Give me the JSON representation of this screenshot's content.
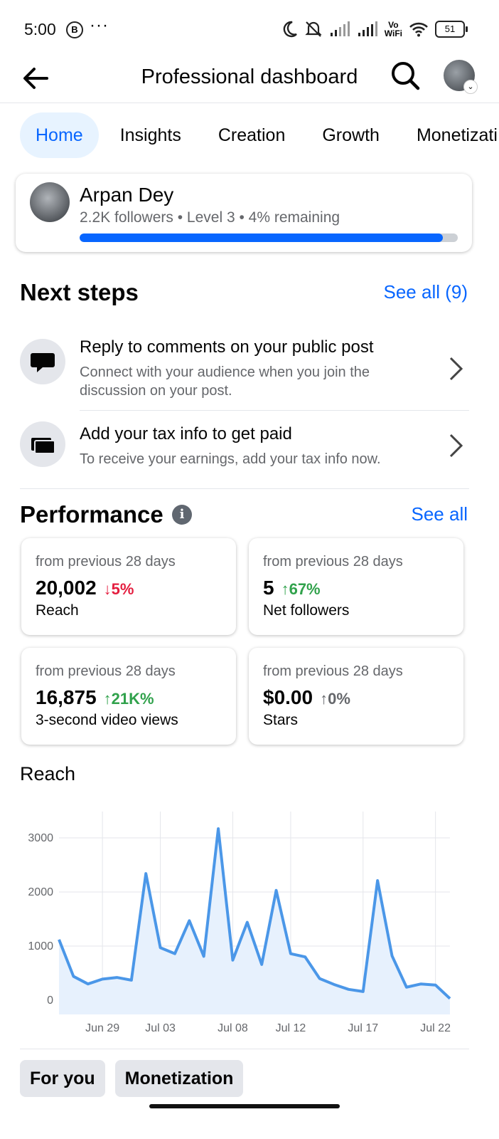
{
  "status_bar": {
    "time": "5:00",
    "b_badge": "B",
    "dots": "···",
    "vo": "Vo",
    "wifi_label": "WiFi",
    "battery": "51"
  },
  "header": {
    "title": "Professional dashboard"
  },
  "tabs": [
    {
      "label": "Home",
      "active": true
    },
    {
      "label": "Insights"
    },
    {
      "label": "Creation"
    },
    {
      "label": "Growth"
    },
    {
      "label": "Monetizati"
    }
  ],
  "profile": {
    "name": "Arpan Dey",
    "meta": "2.2K followers • Level 3 • 4% remaining",
    "progress_fraction": 0.96
  },
  "next_steps": {
    "heading": "Next steps",
    "see_all": "See all (9)",
    "items": [
      {
        "title": "Reply to comments on your public post",
        "desc": "Connect with your audience when you join the discussion on your post.",
        "icon": "comment-bubble-icon"
      },
      {
        "title": "Add your tax info to get paid",
        "desc": "To receive your earnings, add your tax info now.",
        "icon": "cards-icon"
      }
    ]
  },
  "performance": {
    "heading": "Performance",
    "see_all": "See all",
    "cards": [
      {
        "caption": "from previous 28 days",
        "value": "20,002",
        "change": "↓5%",
        "trend": "down",
        "label": "Reach"
      },
      {
        "caption": "from previous 28 days",
        "value": "5",
        "change": "↑67%",
        "trend": "up",
        "label": "Net followers"
      },
      {
        "caption": "from previous 28 days",
        "value": "16,875",
        "change": "↑21K%",
        "trend": "up",
        "label": "3-second video views"
      },
      {
        "caption": "from previous 28 days",
        "value": "$0.00",
        "change": "↑0%",
        "trend": "neutral",
        "label": "Stars"
      }
    ]
  },
  "reach_title": "Reach",
  "chart_data": {
    "type": "area",
    "title": "Reach",
    "ylim": [
      0,
      3000
    ],
    "yticks": [
      "0",
      "1000",
      "2000",
      "3000"
    ],
    "xtick_labels": [
      "Jun 29",
      "Jul 03",
      "Jul 08",
      "Jul 12",
      "Jul 17",
      "Jul 22"
    ],
    "values": [
      1120,
      440,
      300,
      390,
      420,
      370,
      2340,
      970,
      860,
      1470,
      810,
      3170,
      740,
      1440,
      660,
      2030,
      860,
      800,
      400,
      290,
      200,
      160,
      2210,
      820,
      240,
      300,
      280,
      30
    ],
    "color": "#4b97e8",
    "fill": "#e7f1fd",
    "grid": true
  },
  "bottom_tabs": [
    "For you",
    "Monetization"
  ],
  "colors": {
    "accent": "#0866ff",
    "down": "#e41e3f",
    "up": "#31a24c"
  }
}
